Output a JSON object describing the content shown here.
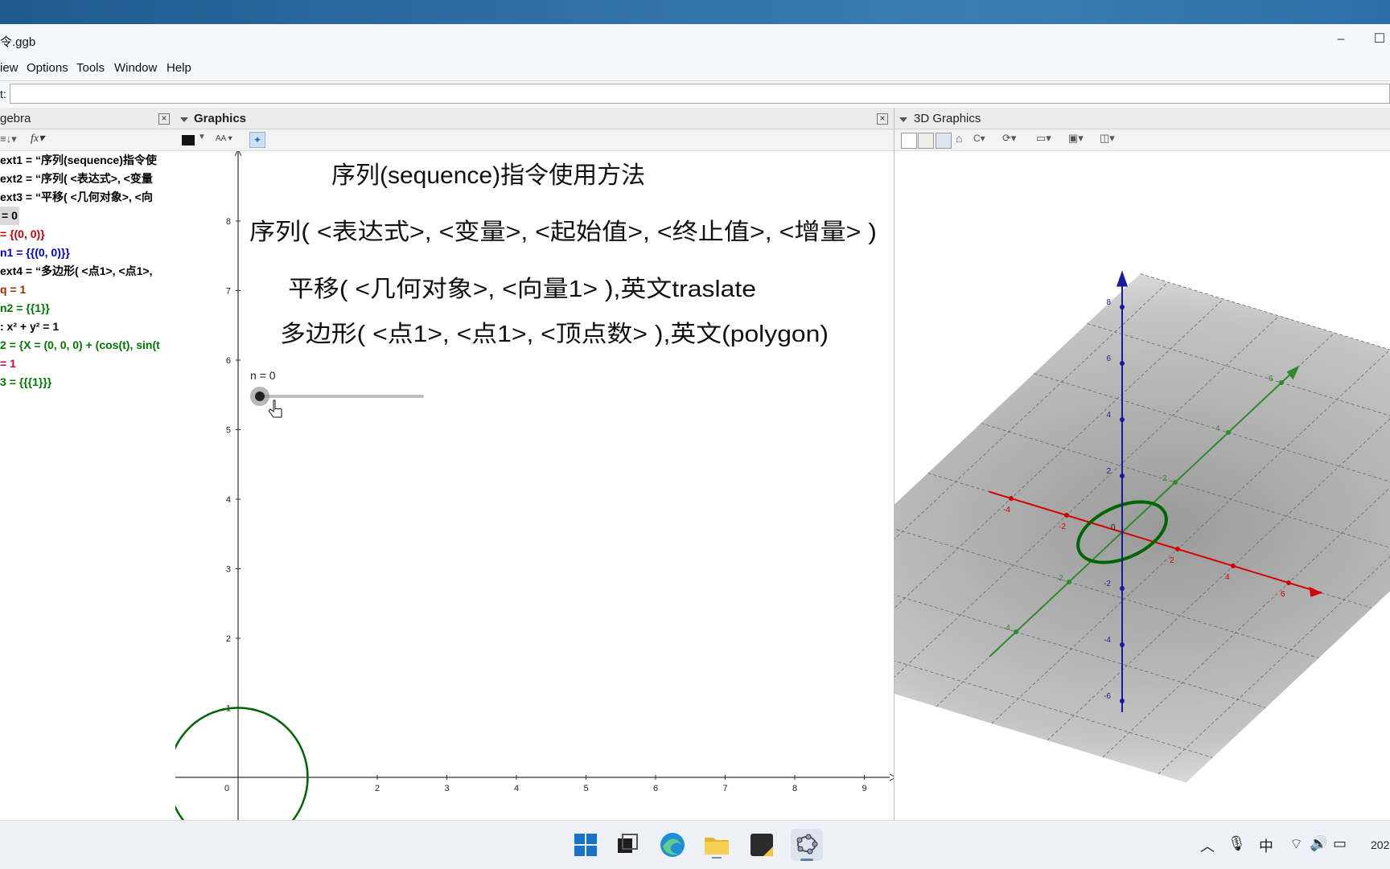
{
  "window": {
    "title": "令.ggb",
    "minimize": "–",
    "maximize": "☐"
  },
  "menu": [
    "iew",
    "Options",
    "Tools",
    "Window",
    "Help"
  ],
  "input_bar": {
    "label": "t:",
    "value": ""
  },
  "algebra": {
    "title": "gebra",
    "items": [
      {
        "text": "ext1 = “序列(sequence)指令使",
        "color": "#000000"
      },
      {
        "text": "ext2 = “序列( <表达式>, <变量",
        "color": "#000000"
      },
      {
        "text": "ext3 = “平移( <几何对象>, <向",
        "color": "#000000"
      },
      {
        "text": " = 0",
        "color": "#000000",
        "selected": true
      },
      {
        "text": " = {(0, 0)}",
        "color": "#cc0000"
      },
      {
        "text": "n1 = {{(0, 0)}}",
        "color": "#0000cc"
      },
      {
        "text": "ext4 = “多边形( <点1>, <点1>,",
        "color": "#000000"
      },
      {
        "text": "q = 1",
        "color": "#993300"
      },
      {
        "text": "n2 = {{1}}",
        "color": "#007700"
      },
      {
        "text": ": x² + y² = 1",
        "color": "#000000"
      },
      {
        "text": "2 = {X = (0, 0, 0) + (cos(t), sin(t",
        "color": "#007700"
      },
      {
        "text": " = 1",
        "color": "#cc0044"
      },
      {
        "text": "3 = {{{1}}}",
        "color": "#007700"
      }
    ]
  },
  "graphics": {
    "title": "Graphics",
    "texts": {
      "t1": "序列(sequence)指令使用方法",
      "t2": "序列( <表达式>, <变量>, <起始值>, <终止值>, <增量> )",
      "t3": "平移( <几何对象>, <向量1> ),英文traslate",
      "t4": "多边形( <点1>, <点1>, <顶点数> ),英文(polygon)"
    },
    "slider": {
      "label": "n = 0",
      "value": 0
    },
    "x_ticks": [
      "0",
      "2",
      "3",
      "4",
      "5",
      "6",
      "7",
      "8",
      "9"
    ],
    "y_ticks": [
      "8",
      "7",
      "6",
      "5",
      "4",
      "3",
      "2",
      "1"
    ]
  },
  "graphics3d": {
    "title": "3D Graphics",
    "z_ticks": [
      "8",
      "6",
      "4",
      "2",
      "-2",
      "-4",
      "-6"
    ],
    "red_ticks": [
      "-4",
      "-2",
      "2",
      "4",
      "6"
    ],
    "green_ticks": [
      "6",
      "4",
      "2",
      "-2",
      "-4"
    ],
    "origin": "0"
  },
  "taskbar": {
    "clock": "202"
  },
  "colors": {
    "accent": "#1a73c9",
    "circle": "#006400",
    "x_axis": "#d40000",
    "y_axis": "#2e8b2e",
    "z_axis": "#1a1aa0"
  }
}
